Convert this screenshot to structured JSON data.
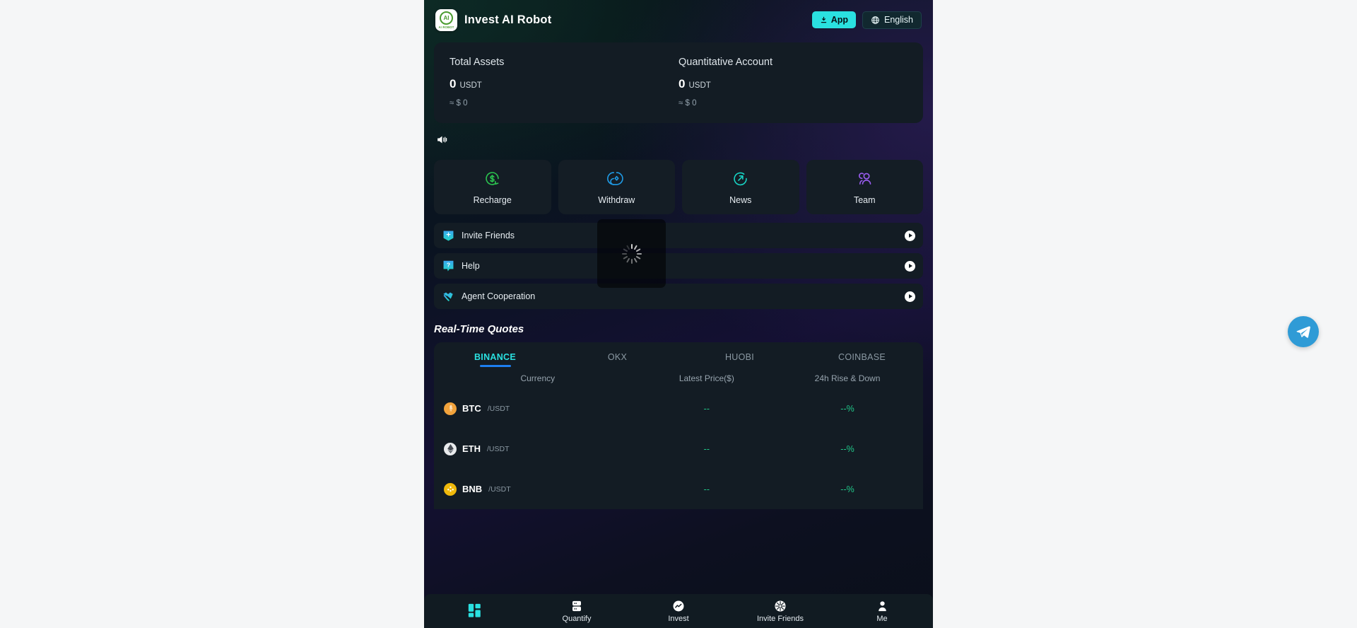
{
  "header": {
    "brand_name": "Invest AI Robot",
    "logo_text": "AI",
    "logo_label": "AI ROBOT",
    "app_button": "App",
    "language_button": "English"
  },
  "assets": {
    "cards": [
      {
        "title": "Total Assets",
        "amount": "0",
        "currency": "USDT",
        "approx": "≈ $ 0"
      },
      {
        "title": "Quantitative Account",
        "amount": "0",
        "currency": "USDT",
        "approx": "≈ $ 0"
      }
    ]
  },
  "announcement": {
    "text": ""
  },
  "actions": [
    {
      "label": "Recharge",
      "icon": "dollar-circle-icon",
      "color": "#2bc24f"
    },
    {
      "label": "Withdraw",
      "icon": "location-pin-icon",
      "color": "#1f9be6"
    },
    {
      "label": "News",
      "icon": "arrow-circle-icon",
      "color": "#18d3c4"
    },
    {
      "label": "Team",
      "icon": "people-icon",
      "color": "#9a5cf0"
    }
  ],
  "rows": [
    {
      "label": "Invite Friends",
      "icon": "invite-inbox-icon"
    },
    {
      "label": "Help",
      "icon": "question-help-icon"
    },
    {
      "label": "Agent Cooperation",
      "icon": "handshake-icon"
    }
  ],
  "quotes": {
    "title": "Real-Time Quotes",
    "exchanges": [
      {
        "label": "BINANCE",
        "active": true
      },
      {
        "label": "OKX",
        "active": false
      },
      {
        "label": "HUOBI",
        "active": false
      },
      {
        "label": "COINBASE",
        "active": false
      }
    ],
    "columns": {
      "currency": "Currency",
      "price": "Latest Price($)",
      "change": "24h Rise & Down"
    },
    "rows": [
      {
        "symbol": "BTC",
        "pair": "/USDT",
        "price": "--",
        "change": "--%",
        "coin_color": "#f2a33c",
        "coin_glyph": "₿"
      },
      {
        "symbol": "ETH",
        "pair": "/USDT",
        "price": "--",
        "change": "--%",
        "coin_color": "#cfd3d8",
        "coin_glyph": "◆"
      },
      {
        "symbol": "BNB",
        "pair": "/USDT",
        "price": "--",
        "change": "--%",
        "coin_color": "#f0b90b",
        "coin_glyph": "◆"
      }
    ]
  },
  "loading": {
    "visible": true,
    "icon": "loading-spinner-icon"
  },
  "bottom_nav": [
    {
      "label": "",
      "icon": "home-grid-icon",
      "active": true
    },
    {
      "label": "Quantify",
      "icon": "server-icon",
      "active": false
    },
    {
      "label": "Invest",
      "icon": "trend-chart-icon",
      "active": false
    },
    {
      "label": "Invite Friends",
      "icon": "aperture-icon",
      "active": false
    },
    {
      "label": "Me",
      "icon": "person-icon",
      "active": false
    }
  ],
  "float_button": {
    "icon": "telegram-icon",
    "color": "#2f9bd6"
  },
  "colors": {
    "accent_cyan": "#2ae0e0",
    "accent_blue": "#1d7ff0",
    "positive_green": "#20c98a",
    "card_bg": "#131c24",
    "nav_bg": "#111b22"
  }
}
